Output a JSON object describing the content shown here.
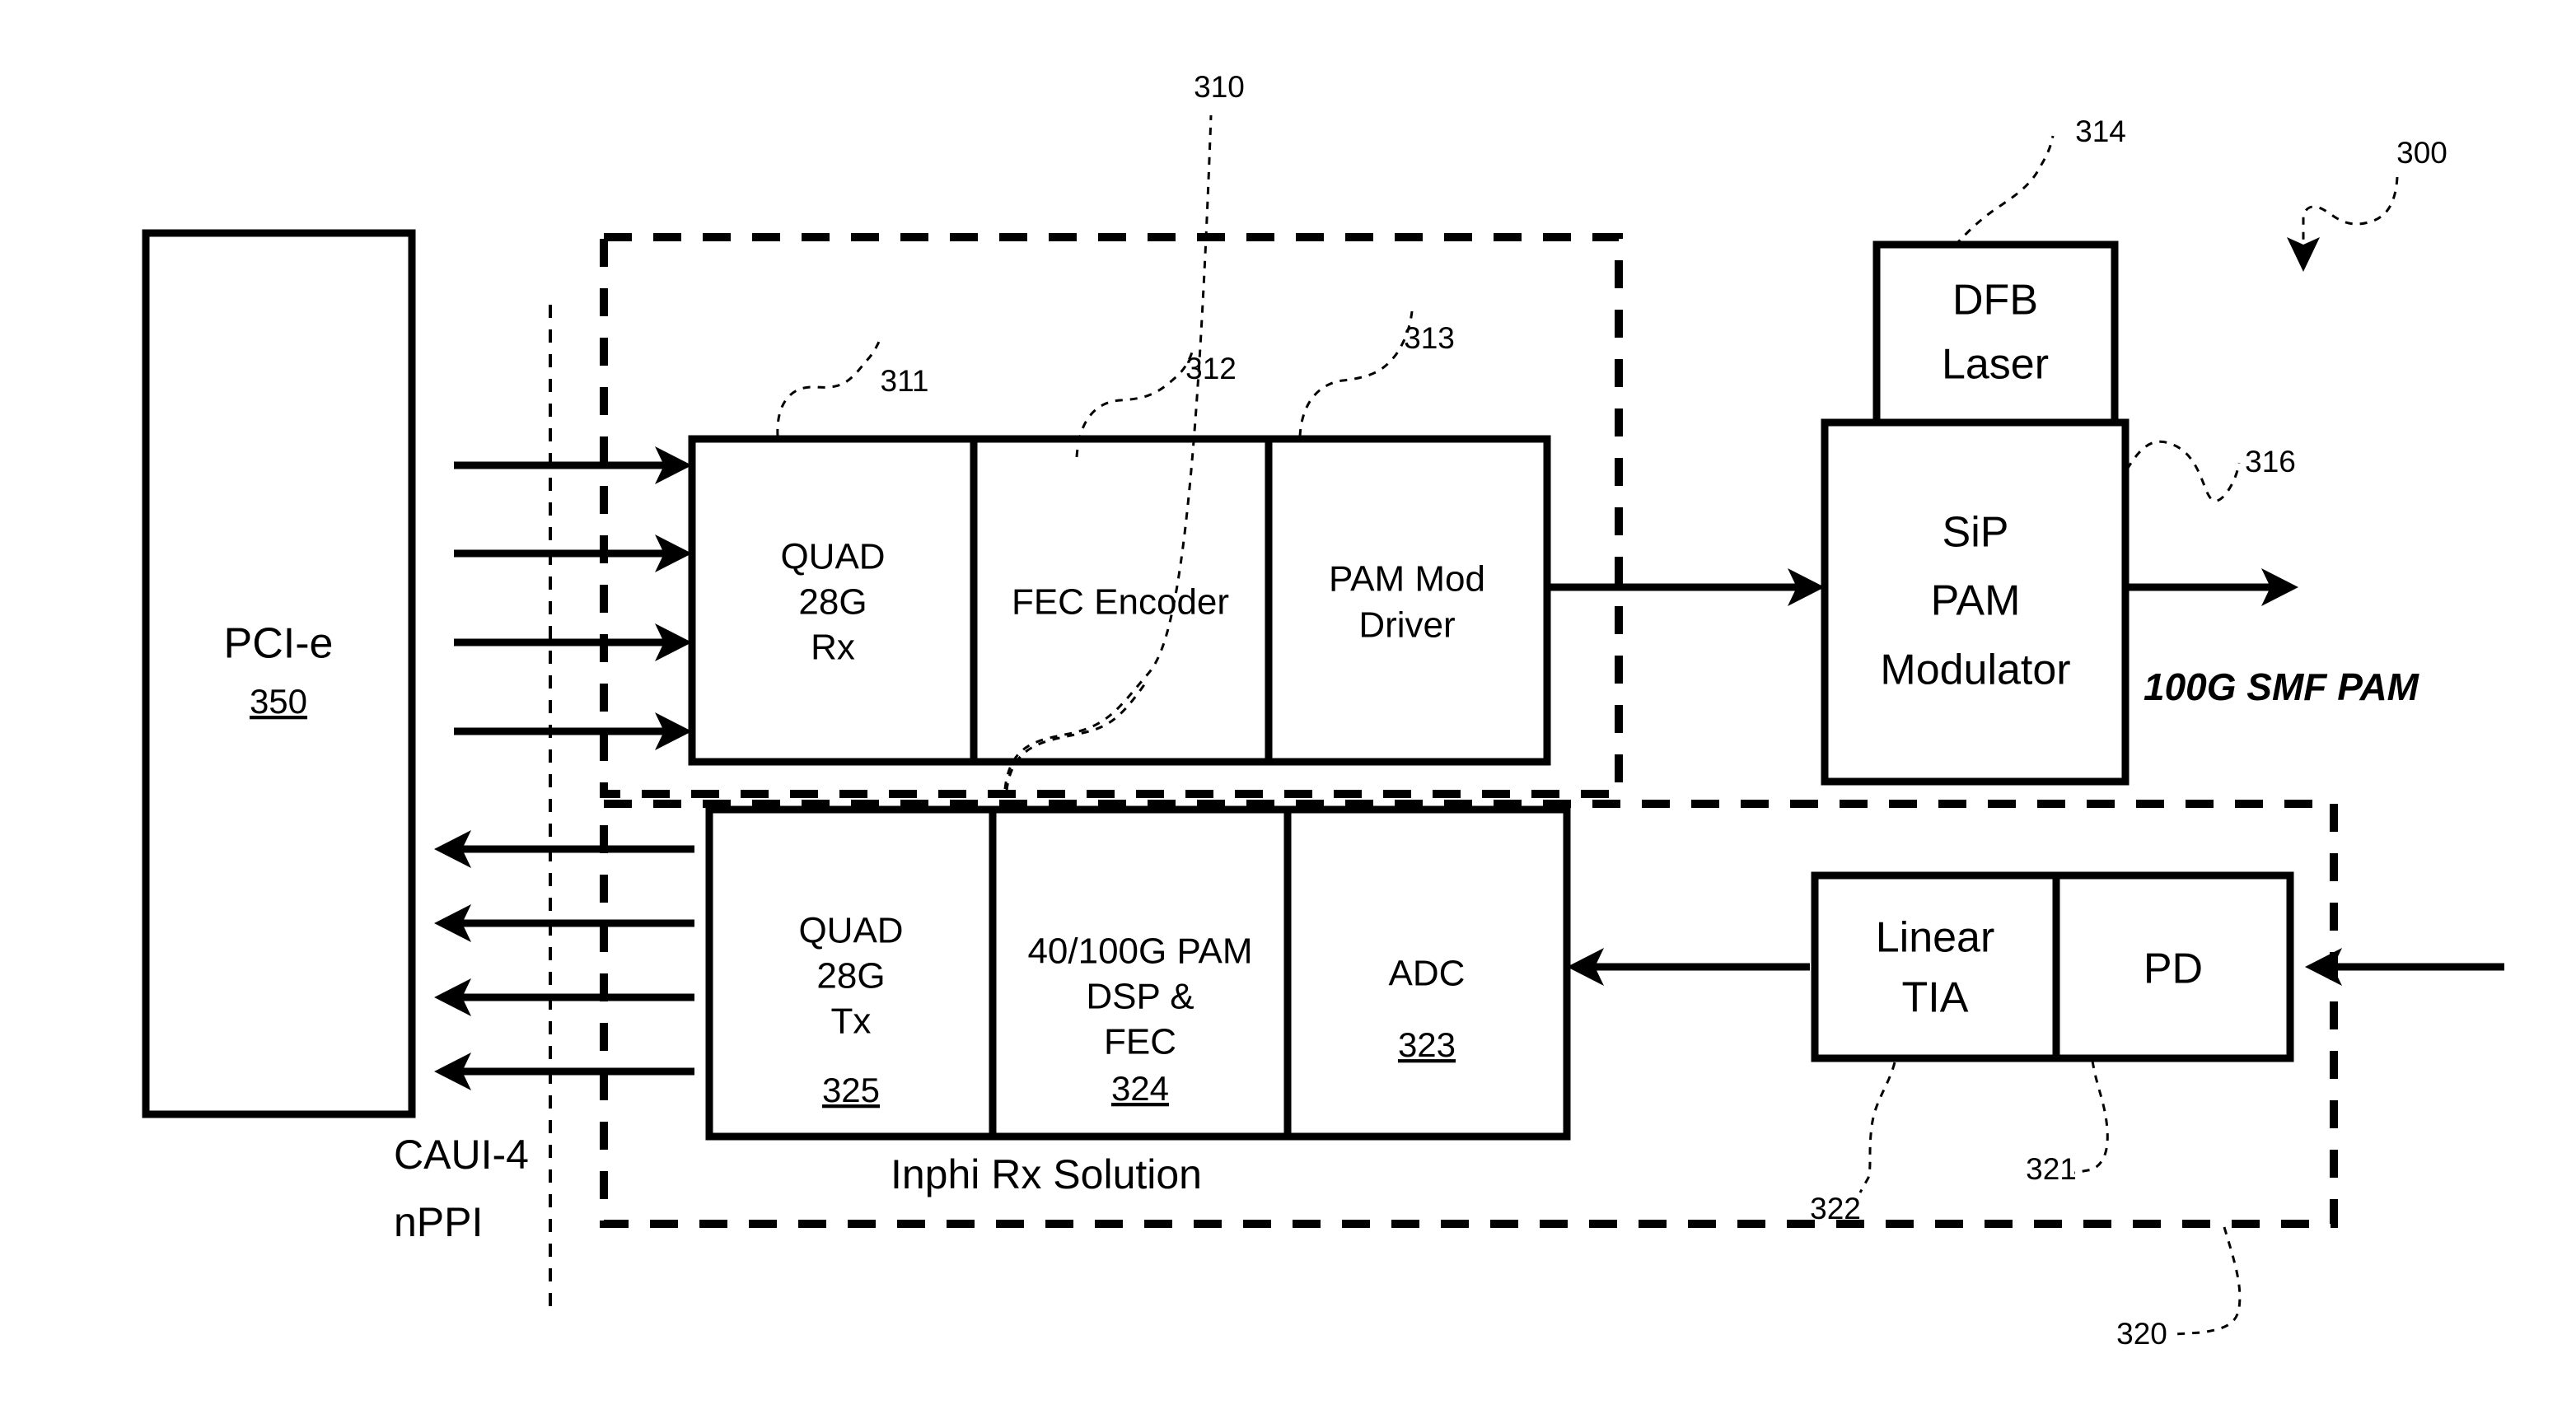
{
  "figure": {
    "title": "PAM optical transceiver block diagram",
    "reference_numerals": {
      "overall": "300",
      "tx_module": "310",
      "quad_rx": "311",
      "fec_encoder": "312",
      "pam_mod_driver": "313",
      "dfb_laser": "314",
      "optical_out": "316",
      "rx_module": "320",
      "pd": "321",
      "linear_tia": "322",
      "adc": "323",
      "pam_dsp_fec": "324",
      "quad_tx": "325",
      "pcie": "350"
    }
  },
  "host": {
    "name": "pcie-block",
    "label": "PCI-e",
    "ref": "350"
  },
  "interface": {
    "line1": "CAUI-4",
    "line2": "nPPI"
  },
  "tx_module": {
    "ref": "310",
    "blocks": [
      {
        "name": "quad-28g-rx",
        "lines": [
          "QUAD",
          "28G",
          "Rx"
        ],
        "ref": "311"
      },
      {
        "name": "fec-encoder",
        "lines": [
          "FEC Encoder"
        ],
        "ref": "312"
      },
      {
        "name": "pam-mod-driver",
        "lines": [
          "PAM Mod",
          "Driver"
        ],
        "ref": "313"
      }
    ]
  },
  "rx_module": {
    "ref": "320",
    "caption": "Inphi Rx Solution",
    "blocks": [
      {
        "name": "quad-28g-tx",
        "lines": [
          "QUAD",
          "28G",
          "Tx"
        ],
        "ref": "325"
      },
      {
        "name": "pam-dsp-fec",
        "lines": [
          "40/100G PAM",
          "DSP &",
          "FEC"
        ],
        "ref": "324"
      },
      {
        "name": "adc",
        "lines": [
          "ADC"
        ],
        "ref": "323"
      }
    ]
  },
  "optics": {
    "laser": {
      "name": "dfb-laser",
      "lines": [
        "DFB",
        "Laser"
      ],
      "ref": "314"
    },
    "modulator": {
      "name": "sip-pam-modulator",
      "lines": [
        "SiP",
        "PAM",
        "Modulator"
      ]
    },
    "output_label": "100G SMF PAM",
    "output_ref": "316",
    "tia": {
      "name": "linear-tia",
      "lines": [
        "Linear",
        "TIA"
      ],
      "ref": "322"
    },
    "pd": {
      "name": "photodiode",
      "lines": [
        "PD"
      ],
      "ref": "321"
    }
  },
  "colors": {
    "ink": "#000000",
    "paper": "#ffffff"
  }
}
